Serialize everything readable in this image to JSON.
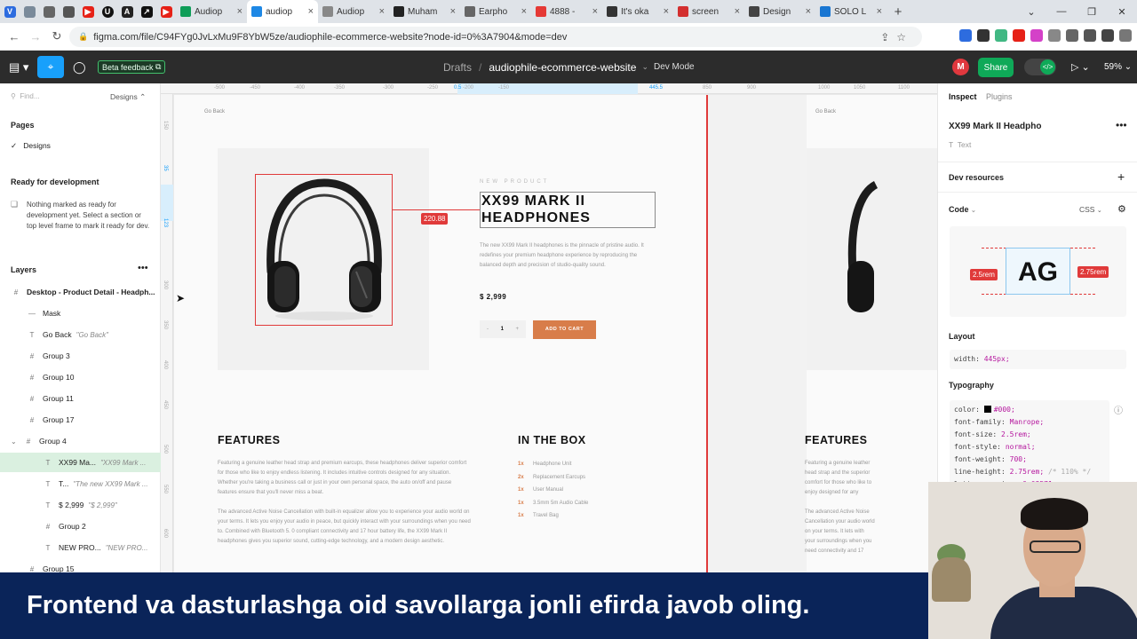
{
  "browser": {
    "tabs": [
      {
        "label": "Audiop",
        "color": "#0f9d58"
      },
      {
        "label": "audiop",
        "color": "#1e88e5",
        "active": true
      },
      {
        "label": "Audiop",
        "color": "#888888"
      },
      {
        "label": "Muham",
        "color": "#222222"
      },
      {
        "label": "Earpho",
        "color": "#666666"
      },
      {
        "label": "4888 -",
        "color": "#e53935"
      },
      {
        "label": "It's oka",
        "color": "#333333"
      },
      {
        "label": "screen",
        "color": "#d32f2f"
      },
      {
        "label": "Design",
        "color": "#444444"
      },
      {
        "label": "SOLO L",
        "color": "#1976d2"
      }
    ],
    "url": "figma.com/file/C94FYg0JvLxMu9F8YbW5ze/audiophile-ecommerce-website?node-id=0%3A7904&mode=dev"
  },
  "toolbar": {
    "beta": "Beta feedback",
    "crumb_team": "Drafts",
    "crumb_sep": "/",
    "crumb_file": "audiophile-ecommerce-website",
    "devmode": "Dev Mode",
    "avatar": "M",
    "share": "Share",
    "zoom": "59%"
  },
  "left": {
    "find": "Find...",
    "designs_dropdown": "Designs",
    "pages_title": "Pages",
    "page_item": "Designs",
    "ready_title": "Ready for development",
    "ready_text": "Nothing marked as ready for development yet. Select a section or top level frame to mark it ready for dev.",
    "layers_title": "Layers",
    "layers": [
      {
        "name": "Desktop - Product Detail - Headph...",
        "glyph": "#",
        "sub": ""
      },
      {
        "name": "Mask",
        "glyph": "—",
        "sub": ""
      },
      {
        "name": "Go Back",
        "glyph": "T",
        "sub": "\"Go Back\""
      },
      {
        "name": "Group 3",
        "glyph": "#",
        "sub": ""
      },
      {
        "name": "Group 10",
        "glyph": "#",
        "sub": ""
      },
      {
        "name": "Group 11",
        "glyph": "#",
        "sub": ""
      },
      {
        "name": "Group 17",
        "glyph": "#",
        "sub": ""
      },
      {
        "name": "Group 4",
        "glyph": "#",
        "sub": ""
      },
      {
        "name": "XX99 Ma...",
        "glyph": "T",
        "sub": "\"XX99 Mark ...",
        "selected": true
      },
      {
        "name": "T...",
        "glyph": "T",
        "sub": "\"The new XX99 Mark ..."
      },
      {
        "name": "$ 2,999",
        "glyph": "T",
        "sub": "\"$ 2,999\""
      },
      {
        "name": "Group 2",
        "glyph": "#",
        "sub": ""
      },
      {
        "name": "NEW PRO...",
        "glyph": "T",
        "sub": "\"NEW PRO..."
      },
      {
        "name": "Group 15",
        "glyph": "#",
        "sub": ""
      }
    ]
  },
  "canvas": {
    "ruler_top": [
      "-500",
      "-450",
      "-400",
      "-350",
      "-300",
      "-250",
      "-200",
      "-150",
      "0.5",
      "445.5",
      "850",
      "900",
      "1000",
      "1050",
      "1100"
    ],
    "ruler_left": [
      "150",
      "35",
      "123",
      "300",
      "350",
      "400",
      "450",
      "500",
      "550",
      "600"
    ],
    "go_back": "Go Back",
    "measure": "220.88",
    "overline": "NEW PRODUCT",
    "title_line1": "XX99 MARK II",
    "title_line2": "HEADPHONES",
    "description": "The new XX99 Mark II headphones is the pinnacle of pristine audio. It redefines your premium headphone experience by reproducing the balanced depth and precision of studio-quality sound.",
    "price": "$ 2,999",
    "qty_minus": "-",
    "qty_value": "1",
    "qty_plus": "+",
    "add_to_cart": "ADD TO CART",
    "features_title": "FEATURES",
    "features_p1": "Featuring a genuine leather head strap and premium earcups, these headphones deliver superior comfort for those who like to enjoy endless listening. It includes intuitive controls designed for any situation. Whether you're taking a business call or just in your own personal space, the auto on/off and pause features ensure that you'll never miss a beat.",
    "features_p2": "The advanced Active Noise Cancellation with built-in equalizer allow you to experience your audio world on your terms. It lets you enjoy your audio in peace, but quickly interact with your surroundings when you need to. Combined with Bluetooth 5. 0 compliant connectivity and 17 hour battery life, the XX99 Mark II headphones gives you superior sound, cutting-edge technology, and a modern design aesthetic.",
    "inbox_title": "IN THE BOX",
    "inbox": [
      {
        "qty": "1x",
        "item": "Headphone Unit"
      },
      {
        "qty": "2x",
        "item": "Replacement Earcups"
      },
      {
        "qty": "1x",
        "item": "User Manual"
      },
      {
        "qty": "1x",
        "item": "3.5mm 5m Audio Cable"
      },
      {
        "qty": "1x",
        "item": "Travel Bag"
      }
    ],
    "frame2_goback": "Go Back",
    "frame2_features": "FEATURES",
    "frame2_p1": "Featuring a genuine leather head strap and the superior comfort for those who like to enjoy designed for any situation. Whether personal space, the auto on/off and",
    "frame2_p2": "The advanced Active Noise Cancellation your audio world on your terms. It lets with your surroundings when you need connectivity and 17 hour battery life, sound, cutting-edge technology, and a"
  },
  "right": {
    "tab_inspect": "Inspect",
    "tab_plugins": "Plugins",
    "layer_name": "XX99 Mark II Headpho",
    "layer_type": "Text",
    "dev_resources": "Dev resources",
    "code_label": "Code",
    "css_label": "CSS",
    "ag": "AG",
    "left_badge": "2.5rem",
    "right_badge": "2.75rem",
    "layout_label": "Layout",
    "width_prop": "width:",
    "width_val": "445px;",
    "typo_label": "Typography",
    "typo": [
      {
        "prop": "color:",
        "val": "#000;",
        "comment": ""
      },
      {
        "prop": "font-family:",
        "val": "Manrope;",
        "comment": ""
      },
      {
        "prop": "font-size:",
        "val": "2.5rem;",
        "comment": ""
      },
      {
        "prop": "font-style:",
        "val": "normal;",
        "comment": ""
      },
      {
        "prop": "font-weight:",
        "val": "700;",
        "comment": ""
      },
      {
        "prop": "line-height:",
        "val": "2.75rem;",
        "comment": "/* 110% */"
      },
      {
        "prop": "letter-spacing:",
        "val": "0.08571rem;",
        "comment": ""
      }
    ]
  },
  "banner": {
    "text": "Frontend va dasturlashga oid savollarga jonli efirda javob oling."
  },
  "colors": {
    "figma_bar": "#2c2c2c",
    "accent": "#d87d4a",
    "selection_red": "#e03a3a",
    "banner": "#0a2459",
    "share_green": "#0fa958"
  }
}
